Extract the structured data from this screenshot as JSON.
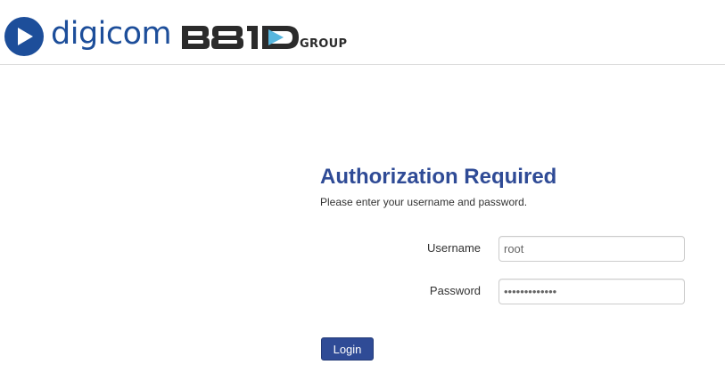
{
  "header": {
    "brand_name": "digicom",
    "partner_logo_text": "B810",
    "group_text": "GROUP",
    "colors": {
      "brand_blue": "#1d4e9a",
      "partner_dark": "#2b2b2b",
      "partner_accent": "#57b6de"
    }
  },
  "auth": {
    "title": "Authorization Required",
    "subtitle": "Please enter your username and password.",
    "username_label": "Username",
    "username_value": "root",
    "password_label": "Password",
    "password_value": "•••••••••••••",
    "login_label": "Login",
    "colors": {
      "title": "#2f4b96",
      "button": "#2f4b96"
    }
  }
}
